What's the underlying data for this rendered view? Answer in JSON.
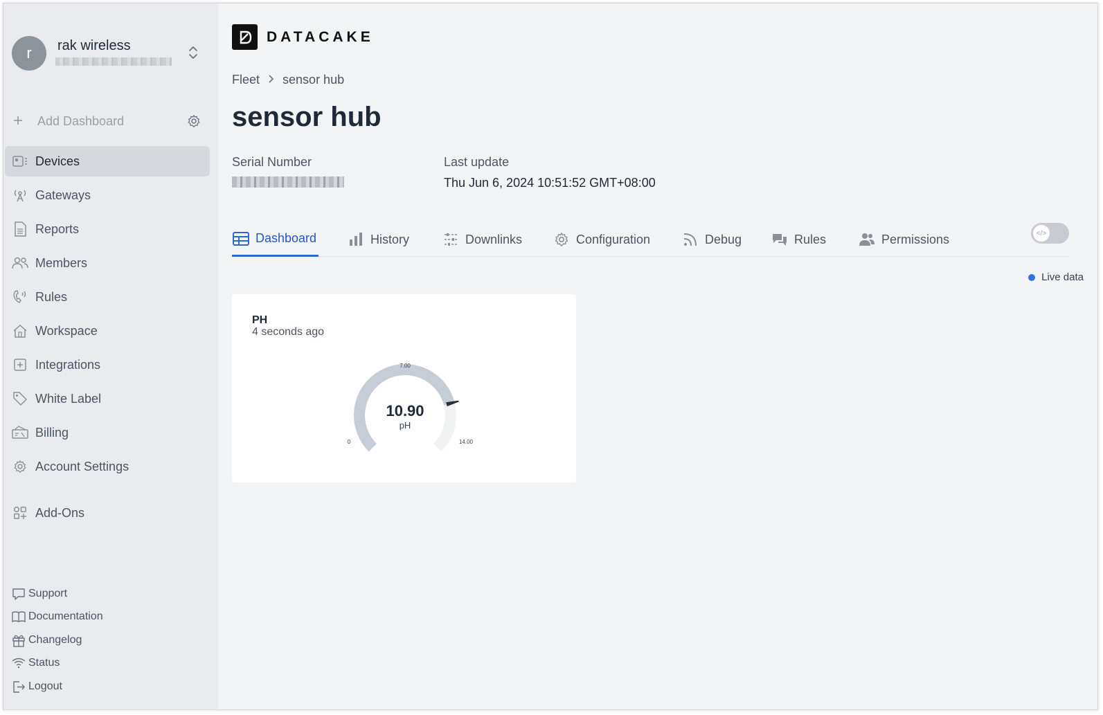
{
  "org": {
    "avatar_letter": "r",
    "name": "rak wireless"
  },
  "sidebar": {
    "add_dashboard": "Add Dashboard",
    "items": [
      {
        "label": "Devices",
        "icon": "devices-icon",
        "active": true
      },
      {
        "label": "Gateways",
        "icon": "gateway-icon"
      },
      {
        "label": "Reports",
        "icon": "report-icon"
      },
      {
        "label": "Members",
        "icon": "members-icon"
      },
      {
        "label": "Rules",
        "icon": "rules-icon"
      },
      {
        "label": "Workspace",
        "icon": "workspace-icon"
      },
      {
        "label": "Integrations",
        "icon": "integrations-icon"
      },
      {
        "label": "White Label",
        "icon": "tag-icon"
      },
      {
        "label": "Billing",
        "icon": "billing-icon"
      },
      {
        "label": "Account Settings",
        "icon": "gear-icon"
      }
    ],
    "addons": {
      "label": "Add-Ons",
      "icon": "addons-icon"
    },
    "footer": [
      {
        "label": "Support",
        "icon": "chat-icon"
      },
      {
        "label": "Documentation",
        "icon": "book-icon"
      },
      {
        "label": "Changelog",
        "icon": "gift-icon"
      },
      {
        "label": "Status",
        "icon": "wifi-icon"
      },
      {
        "label": "Logout",
        "icon": "logout-icon"
      }
    ]
  },
  "main": {
    "logo_text": "DATACAKE",
    "breadcrumb": {
      "root": "Fleet",
      "current": "sensor hub"
    },
    "title": "sensor hub",
    "serial_label": "Serial Number",
    "last_update_label": "Last update",
    "last_update_value": "Thu Jun 6, 2024 10:51:52 GMT+08:00",
    "tabs": [
      {
        "label": "Dashboard",
        "icon": "table-icon",
        "active": true
      },
      {
        "label": "History",
        "icon": "bar-chart-icon"
      },
      {
        "label": "Downlinks",
        "icon": "sliders-icon"
      },
      {
        "label": "Configuration",
        "icon": "gear-icon"
      },
      {
        "label": "Debug",
        "icon": "rss-icon"
      },
      {
        "label": "Rules",
        "icon": "comments-icon"
      },
      {
        "label": "Permissions",
        "icon": "users-icon"
      }
    ],
    "live_label": "Live data",
    "colors": {
      "accent": "#2f66d0",
      "live_dot": "#2f76e5"
    }
  },
  "widget": {
    "title": "PH",
    "subtitle": "4 seconds ago",
    "gauge": {
      "value": 10.9,
      "value_label": "10.90",
      "unit": "pH",
      "min": 0,
      "max": 14,
      "min_label": "0",
      "mid_label": "7.00",
      "max_label": "14.00"
    }
  }
}
